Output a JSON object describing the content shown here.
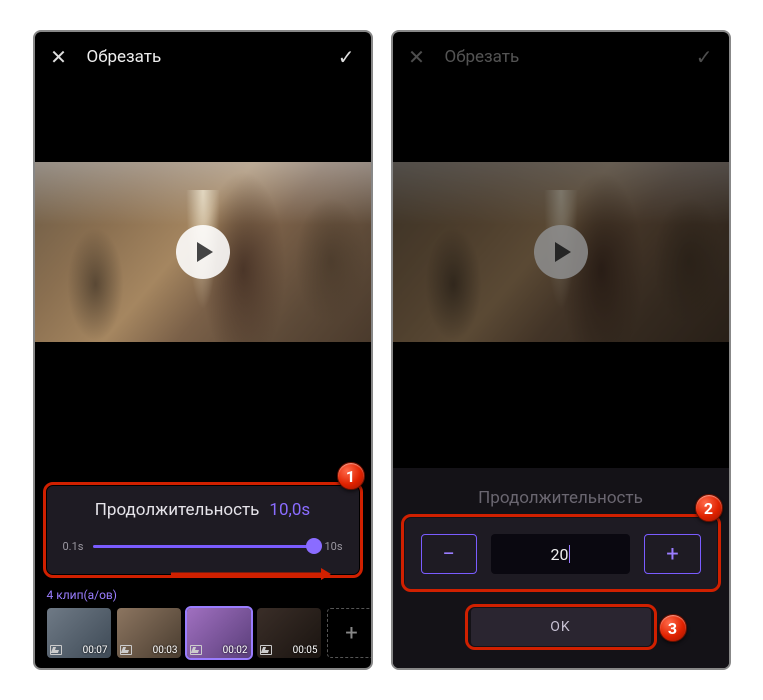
{
  "left": {
    "header": {
      "title": "Обрезать"
    },
    "duration": {
      "label": "Продолжительность",
      "value": "10,0s",
      "min": "0.1s",
      "max": "10s"
    },
    "clips": {
      "count_label": "4 клип(а/ов)",
      "items": [
        {
          "time": "00:07"
        },
        {
          "time": "00:03"
        },
        {
          "time": "00:02"
        },
        {
          "time": "00:05"
        }
      ]
    },
    "callout": "1"
  },
  "right": {
    "header": {
      "title": "Обрезать"
    },
    "duration_label": "Продолжительность",
    "stepper": {
      "value": "20"
    },
    "ok_label": "OK",
    "callout_stepper": "2",
    "callout_ok": "3"
  }
}
